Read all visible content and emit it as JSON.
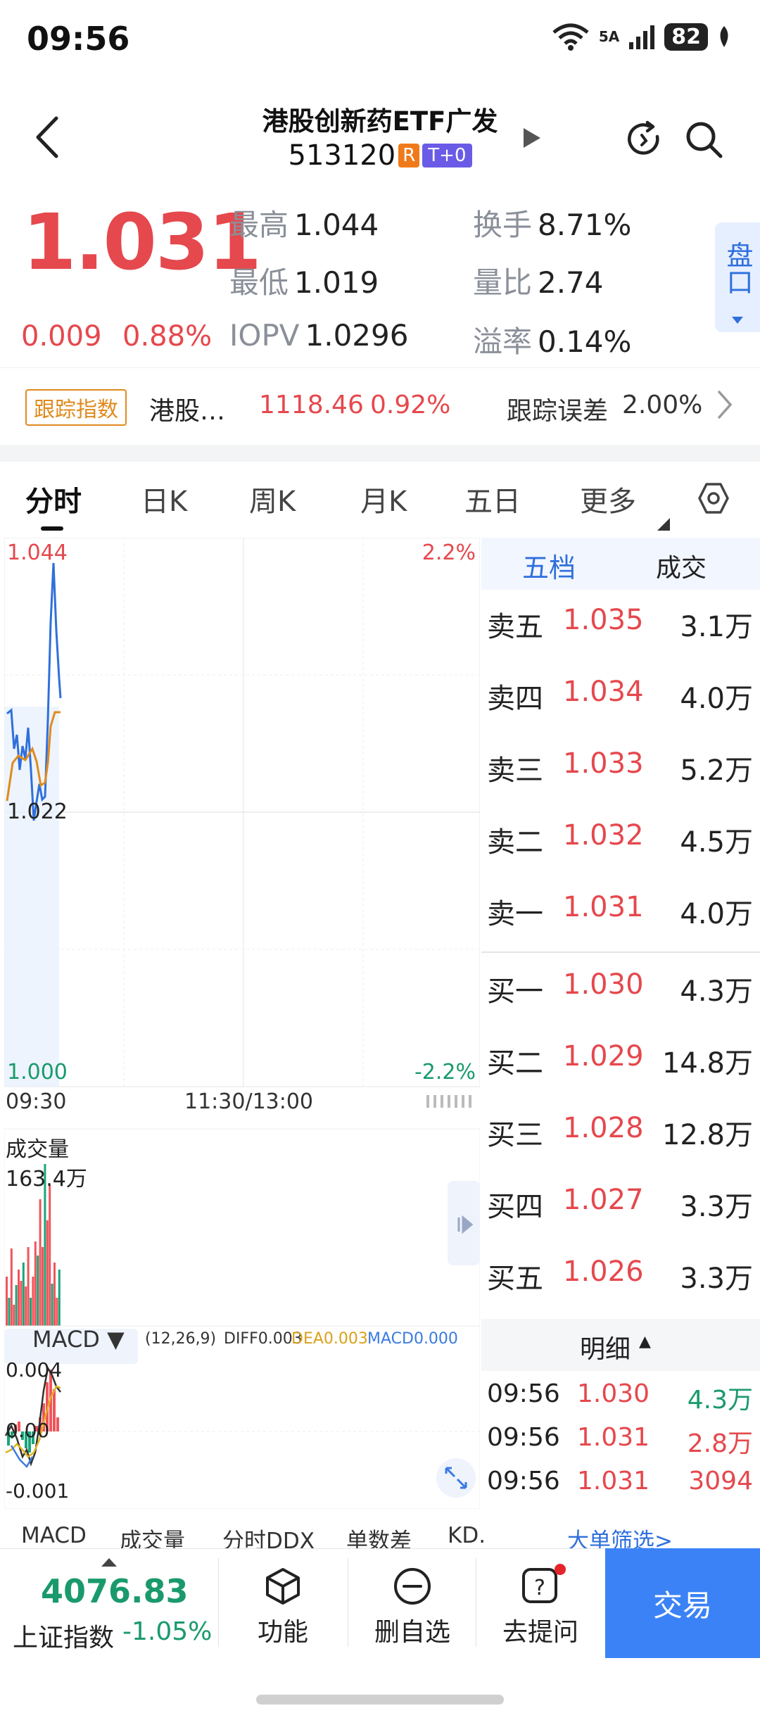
{
  "status_bar": {
    "time": "09:56",
    "network": "5A",
    "battery": "82"
  },
  "header": {
    "title": "港股创新药ETF广发",
    "code": "513120",
    "badge_r": "R",
    "badge_t": "T+0"
  },
  "quote": {
    "price": "1.031",
    "change": "0.009",
    "change_pct": "0.88%",
    "high_label": "最高",
    "high": "1.044",
    "low_label": "最低",
    "low": "1.019",
    "iopv_label": "IOPV",
    "iopv": "1.0296",
    "turnover_label": "换手",
    "turnover": "8.71%",
    "vol_ratio_label": "量比",
    "vol_ratio": "2.74",
    "premium_label": "溢率",
    "premium": "0.14%",
    "pankou": "盘口"
  },
  "tracking": {
    "tag": "跟踪指数",
    "index_name": "港股…",
    "index_value": "1118.46",
    "index_pct": "0.92%",
    "error_label": "跟踪误差",
    "error_value": "2.00%"
  },
  "tabs": [
    "分时",
    "日K",
    "周K",
    "月K",
    "五日",
    "更多"
  ],
  "chart": {
    "price_top": "1.044",
    "price_mid": "1.022",
    "price_bot": "1.000",
    "pct_top": "2.2%",
    "pct_bot": "-2.2%",
    "time_start": "09:30",
    "time_mid": "11:30/13:00",
    "volume_label": "成交量",
    "volume_max": "163.4万",
    "macd_label": "MACD",
    "macd_params": "(12,26,9)",
    "diff": "DIFF0.003",
    "dea": "DEA0.003",
    "macd_val": "MACD0.000",
    "macd_top": "0.004",
    "macd_mid": "0.00",
    "macd_bot": "-0.001",
    "colors": {
      "price_line": "#2f6fdc",
      "avg_line": "#e08a1e",
      "up": "#f0555b",
      "down": "#1aa57a"
    }
  },
  "order_book": {
    "tab_five": "五档",
    "tab_trade": "成交",
    "asks": [
      {
        "label": "卖五",
        "price": "1.035",
        "vol": "3.1万"
      },
      {
        "label": "卖四",
        "price": "1.034",
        "vol": "4.0万"
      },
      {
        "label": "卖三",
        "price": "1.033",
        "vol": "5.2万"
      },
      {
        "label": "卖二",
        "price": "1.032",
        "vol": "4.5万"
      },
      {
        "label": "卖一",
        "price": "1.031",
        "vol": "4.0万"
      }
    ],
    "bids": [
      {
        "label": "买一",
        "price": "1.030",
        "vol": "4.3万"
      },
      {
        "label": "买二",
        "price": "1.029",
        "vol": "14.8万"
      },
      {
        "label": "买三",
        "price": "1.028",
        "vol": "12.8万"
      },
      {
        "label": "买四",
        "price": "1.027",
        "vol": "3.3万"
      },
      {
        "label": "买五",
        "price": "1.026",
        "vol": "3.3万"
      }
    ],
    "detail_label": "明细",
    "details": [
      {
        "time": "09:56",
        "price": "1.030",
        "vol": "4.3万"
      },
      {
        "time": "09:56",
        "price": "1.031",
        "vol": "2.8万"
      },
      {
        "time": "09:56",
        "price": "1.031",
        "vol": "3094"
      }
    ],
    "big_order": "大单筛选>"
  },
  "indicator_tabs": [
    "MACD",
    "成交量",
    "分时DDX",
    "单数差",
    "KD."
  ],
  "bottom": {
    "index_value": "4076.83",
    "index_name": "上证指数",
    "index_change": "-1.05%",
    "func": "功能",
    "remove": "删自选",
    "ask": "去提问",
    "trade": "交易"
  }
}
